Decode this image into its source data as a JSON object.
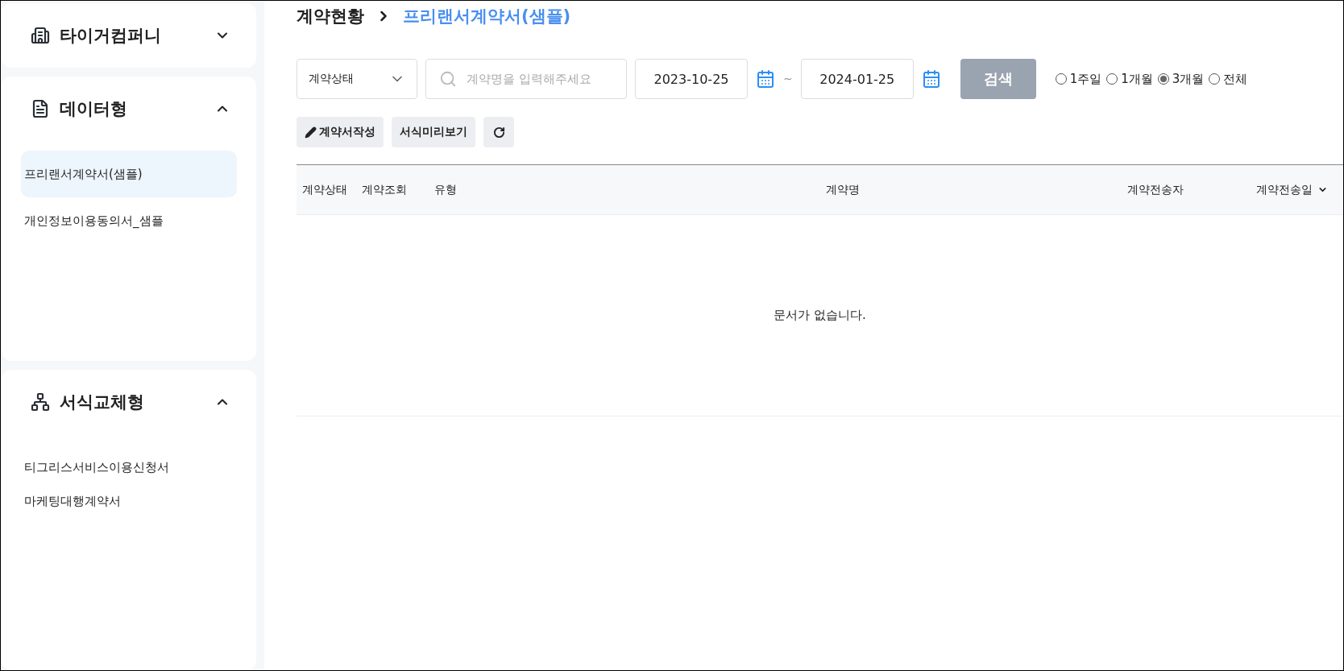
{
  "sidebar": {
    "groups": [
      {
        "kind": "company",
        "title": "타이거컴퍼니",
        "expanded": false
      },
      {
        "kind": "data",
        "title": "데이터형",
        "expanded": true,
        "items": [
          {
            "label": "프리랜서계약서(샘플)",
            "selected": true
          },
          {
            "label": "개인정보이용동의서_샘플",
            "selected": false
          }
        ]
      },
      {
        "kind": "template",
        "title": "서식교체형",
        "expanded": true,
        "items": [
          {
            "label": "티그리스서비스이용신청서",
            "selected": false
          },
          {
            "label": "마케팅대행계약서",
            "selected": false
          }
        ]
      }
    ]
  },
  "breadcrumb": {
    "parent": "계약현황",
    "current": "프리랜서계약서(샘플)"
  },
  "filters": {
    "status_select": {
      "value": "계약상태"
    },
    "search": {
      "placeholder": "계약명을 입력해주세요"
    },
    "date_from": "2023-10-25",
    "separator": "~",
    "date_to": "2024-01-25",
    "search_button": {
      "label": "검색",
      "disabled": true
    },
    "periods": [
      {
        "label": "1주일",
        "selected": false
      },
      {
        "label": "1개월",
        "selected": false
      },
      {
        "label": "3개월",
        "selected": true
      },
      {
        "label": "전체",
        "selected": false
      }
    ]
  },
  "actions": [
    {
      "kind": "write",
      "label": "계약서작성"
    },
    {
      "kind": "preview",
      "label": "서식미리보기"
    },
    {
      "kind": "refresh"
    }
  ],
  "table": {
    "columns": [
      {
        "label": "계약상태",
        "sorted": false
      },
      {
        "label": "계약조회",
        "sorted": false
      },
      {
        "label": "유형",
        "sorted": false
      },
      {
        "label": "계약명",
        "sorted": false
      },
      {
        "label": "계약전송자",
        "sorted": false
      },
      {
        "label": "계약전송일",
        "sorted": true
      }
    ],
    "empty_message": "문서가 없습니다."
  }
}
